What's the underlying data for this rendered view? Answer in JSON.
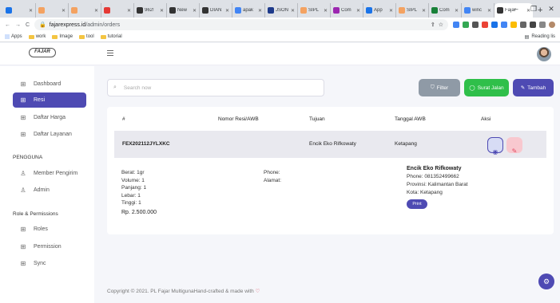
{
  "browser": {
    "tabs": [
      {
        "label": "",
        "color": "#1a73e8"
      },
      {
        "label": "",
        "color": "#f4a261"
      },
      {
        "label": "",
        "color": "#f4a261"
      },
      {
        "label": "",
        "color": "#e53935"
      },
      {
        "label": "962!",
        "color": "#333333"
      },
      {
        "label": "New",
        "color": "#333333"
      },
      {
        "label": "DIAN",
        "color": "#333333"
      },
      {
        "label": "apak",
        "color": "#4285f4"
      },
      {
        "label": "JSON",
        "color": "#1e3a8a"
      },
      {
        "label": "SIPL",
        "color": "#f4a261"
      },
      {
        "label": "Com",
        "color": "#9c27b0"
      },
      {
        "label": "App",
        "color": "#1a73e8"
      },
      {
        "label": "SIPL",
        "color": "#f4a261"
      },
      {
        "label": "Com",
        "color": "#188038"
      },
      {
        "label": "winc",
        "color": "#4285f4"
      },
      {
        "label": "Fajar",
        "color": "#333333"
      }
    ],
    "new_tab": "+",
    "url_host": "fajarexpress.id",
    "url_path": "/admin/orders",
    "bookmarks": [
      "Apps",
      "work",
      "Image",
      "tool",
      "tutorial"
    ],
    "reading_list": "Reading lis"
  },
  "app": {
    "logo_text": "FAJAR"
  },
  "sidebar": {
    "items": [
      {
        "label": "Dashboard",
        "icon": "grid-icon"
      },
      {
        "label": "Resi",
        "icon": "grid-icon",
        "active": true
      },
      {
        "label": "Daftar Harga",
        "icon": "grid-icon"
      },
      {
        "label": "Daftar Layanan",
        "icon": "grid-icon"
      }
    ],
    "section_pengguna": "PENGGUNA",
    "pengguna_items": [
      {
        "label": "Member Pengirim",
        "icon": "user-icon"
      },
      {
        "label": "Admin",
        "icon": "user-icon"
      }
    ],
    "section_roles": "Role & Permissions",
    "roles_items": [
      {
        "label": "Roles",
        "icon": "grid-icon"
      },
      {
        "label": "Permission",
        "icon": "grid-icon"
      },
      {
        "label": "Sync",
        "icon": "grid-icon"
      }
    ]
  },
  "toolbar": {
    "search_placeholder": "Search now",
    "filter_label": "Filter",
    "surat_jalan_label": "Surat Jalan",
    "tambah_label": "Tambah"
  },
  "table": {
    "headers": [
      "#",
      "Nomor Resi/AWB",
      "Tujuan",
      "Tanggal AWB",
      "Aksi"
    ],
    "row": {
      "id": "FEX202112JYLXKC",
      "tujuan": "Encik Eko Rifkowaty",
      "tanggal": "Ketapang"
    },
    "detail": {
      "berat": "Berat: 1gr",
      "volume": "Volume: 1",
      "panjang": "Panjang: 1",
      "lebar": "Lebar: 1",
      "tinggi": "Tinggi: 1",
      "total": "Rp. 2.500.000",
      "phone": "Phone:",
      "alamat": "Alamat:",
      "recipient_name": "Encik Eko Rifkowaty",
      "recipient_phone": "Phone: 081352499662",
      "recipient_provinsi": "Provinsi: Kalimantan Barat",
      "recipient_kota": "Kota: Ketapang",
      "print_label": "Print"
    }
  },
  "footer": {
    "text": "Copyright © 2021. PL Fajar MultigunaHand-crafted & made with",
    "heart": "♡"
  },
  "colors": {
    "primary": "#4e4ab3",
    "success": "#2fbf4a",
    "muted": "#8f9aa6",
    "danger": "#e34a63"
  }
}
